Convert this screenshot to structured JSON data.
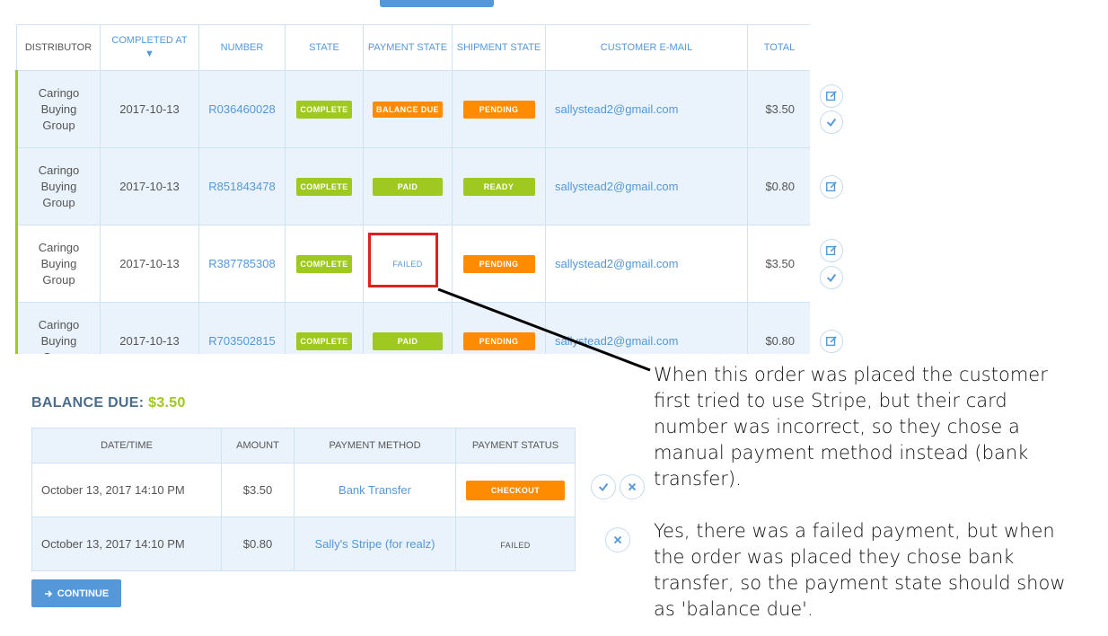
{
  "orders": {
    "columns": {
      "distributor": "DISTRIBUTOR",
      "completed_at": "COMPLETED AT",
      "sort_indicator": "▼",
      "number": "NUMBER",
      "state": "STATE",
      "payment_state": "PAYMENT STATE",
      "shipment_state": "SHIPMENT STATE",
      "customer_email": "CUSTOMER E-MAIL",
      "total": "TOTAL"
    },
    "rows": [
      {
        "distributor": "Caringo Buying Group",
        "completed_at": "2017-10-13",
        "number": "R036460028",
        "state": "COMPLETE",
        "payment_state": "BALANCE DUE",
        "shipment_state": "PENDING",
        "email": "sallystead2@gmail.com",
        "total": "$3.50"
      },
      {
        "distributor": "Caringo Buying Group",
        "completed_at": "2017-10-13",
        "number": "R851843478",
        "state": "COMPLETE",
        "payment_state": "PAID",
        "shipment_state": "READY",
        "email": "sallystead2@gmail.com",
        "total": "$0.80"
      },
      {
        "distributor": "Caringo Buying Group",
        "completed_at": "2017-10-13",
        "number": "R387785308",
        "state": "COMPLETE",
        "payment_state": "FAILED",
        "shipment_state": "PENDING",
        "email": "sallystead2@gmail.com",
        "total": "$3.50"
      },
      {
        "distributor": "Caringo Buying Group",
        "completed_at": "2017-10-13",
        "number": "R703502815",
        "state": "COMPLETE",
        "payment_state": "PAID",
        "shipment_state": "PENDING",
        "email": "sallystead2@gmail.com",
        "total": "$0.80"
      }
    ]
  },
  "annotations": {
    "note1": "When this order was placed the customer first tried to use Stripe, but their card number was incorrect, so they chose a manual payment method instead (bank transfer).",
    "note2": "Yes, there was a failed payment, but when the order was placed they chose bank transfer, so the payment state should show as 'balance due'."
  },
  "balance": {
    "label": "BALANCE DUE:",
    "amount": "$3.50"
  },
  "payments": {
    "columns": {
      "datetime": "DATE/TIME",
      "amount": "AMOUNT",
      "method": "PAYMENT METHOD",
      "status": "PAYMENT STATUS"
    },
    "rows": [
      {
        "datetime": "October 13, 2017 14:10 PM",
        "amount": "$3.50",
        "method": "Bank Transfer",
        "status": "CHECKOUT"
      },
      {
        "datetime": "October 13, 2017 14:10 PM",
        "amount": "$0.80",
        "method": "Sally's Stripe (for realz)",
        "status": "FAILED"
      }
    ]
  },
  "continue_button": {
    "icon": "arrow-right-icon",
    "label": "CONTINUE"
  },
  "colors": {
    "accent": "#5498da",
    "green": "#9fc820",
    "orange": "#ff8c00",
    "highlight": "#e02020"
  }
}
